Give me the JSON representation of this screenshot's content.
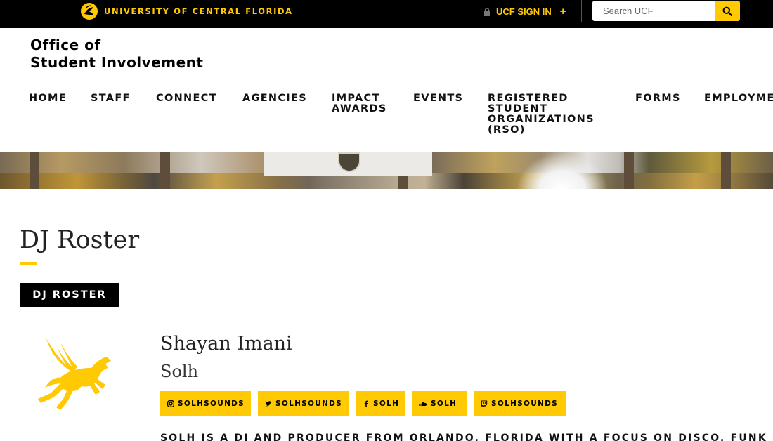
{
  "topbar": {
    "university_name": "UNIVERSITY OF CENTRAL FLORIDA",
    "signin_label": "UCF SIGN IN",
    "signin_plus": "+",
    "search_placeholder": "Search UCF",
    "accent_color": "#ffc904",
    "icons": [
      "ucf-pegasus-icon",
      "lock-icon",
      "search-icon"
    ]
  },
  "office": {
    "line1": "Office of",
    "line2": "Student Involvement"
  },
  "nav": {
    "items": [
      {
        "label": "HOME"
      },
      {
        "label": "STAFF"
      },
      {
        "label": "CONNECT"
      },
      {
        "label": "AGENCIES"
      },
      {
        "label": "IMPACT\nAWARDS"
      },
      {
        "label": "EVENTS"
      },
      {
        "label": "REGISTERED\nSTUDENT\nORGANIZATIONS\n(RSO)"
      },
      {
        "label": "FORMS"
      },
      {
        "label": "EMPLOYME"
      }
    ]
  },
  "main": {
    "title": "DJ Roster",
    "tag": "DJ ROSTER",
    "dj": {
      "name": "Shayan Imani",
      "alias": "Solh",
      "socials": [
        {
          "icon": "instagram-icon",
          "label": "SOLHSOUNDS"
        },
        {
          "icon": "twitter-icon",
          "label": "SOLHSOUNDS"
        },
        {
          "icon": "facebook-icon",
          "label": "SOLH"
        },
        {
          "icon": "soundcloud-icon",
          "label": "SOLH"
        },
        {
          "icon": "twitch-icon",
          "label": "SOLHSOUNDS"
        }
      ],
      "bio": "SOLH IS A DJ AND PRODUCER FROM ORLANDO, FLORIDA WITH A FOCUS ON DISCO, FUNK"
    }
  }
}
